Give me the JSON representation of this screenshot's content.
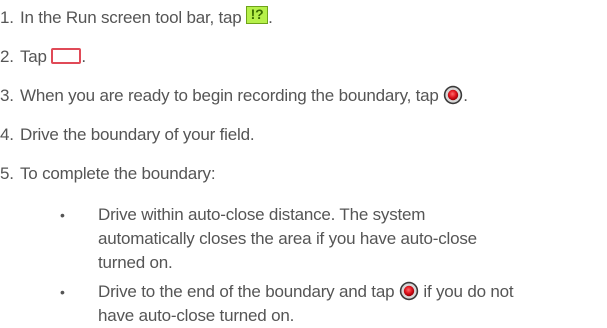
{
  "steps": [
    {
      "number": "1.",
      "text_before": "In the Run screen tool bar, tap ",
      "icon": "boundary-tool-icon",
      "text_after": "."
    },
    {
      "number": "2.",
      "text_before": "Tap ",
      "icon": "rectangle-button-icon",
      "text_after": "."
    },
    {
      "number": "3.",
      "text_before": "When you are ready to begin recording the boundary, tap ",
      "icon": "record-icon",
      "text_after": "."
    },
    {
      "number": "4.",
      "text": "Drive the boundary of your field."
    },
    {
      "number": "5.",
      "text": "To complete the boundary:"
    }
  ],
  "bullets": [
    {
      "marker": "•",
      "line1": "Drive within auto-close distance. The system",
      "line2": "automatically closes the area if you have auto-close",
      "line3": "turned on."
    },
    {
      "marker": "•",
      "line1_before": "Drive to the end of the boundary and tap ",
      "line1_icon": "record-icon",
      "line1_after": " if you do not",
      "line2": "have auto-close turned on."
    }
  ],
  "icons": {
    "boundary_tool_glyph": "!?",
    "boundary_tool_color": "#b6f04a",
    "rect_button_color": "#e04a57",
    "record_color": "#e0141e"
  }
}
